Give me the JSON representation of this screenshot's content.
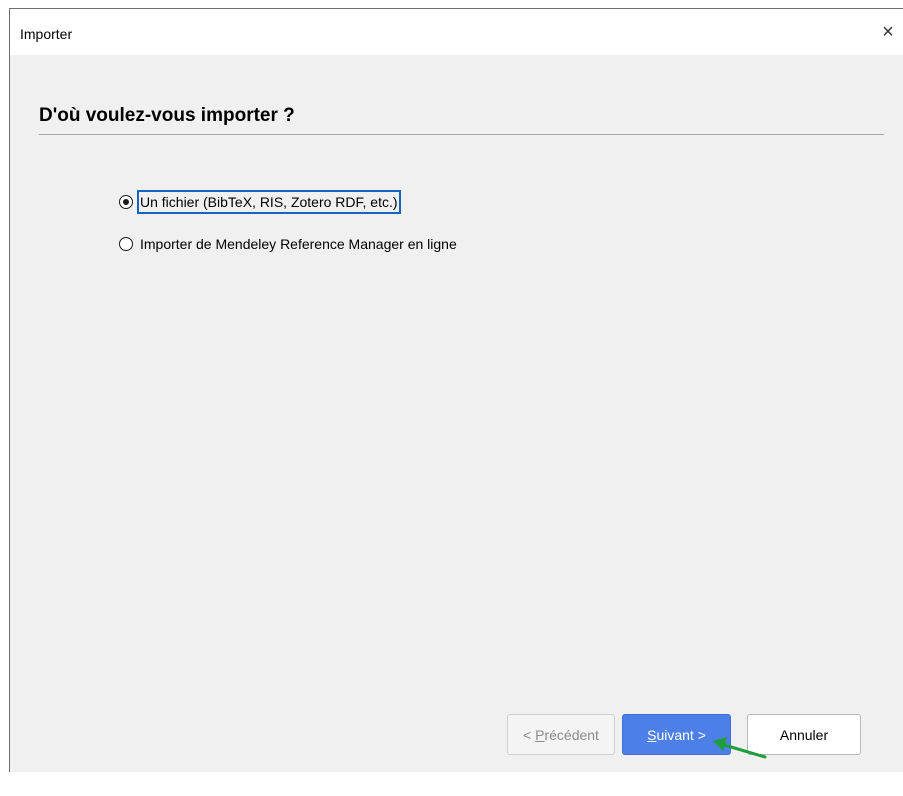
{
  "window": {
    "title": "Importer",
    "close_glyph": "×"
  },
  "heading": "D'où voulez-vous importer ?",
  "options": [
    {
      "label": "Un fichier (BibTeX, RIS, Zotero RDF, etc.)",
      "selected": true
    },
    {
      "label": "Importer de Mendeley Reference Manager en ligne",
      "selected": false
    }
  ],
  "buttons": {
    "prev": {
      "prefix": "< ",
      "mnemonic": "P",
      "rest": "récédent",
      "enabled": false
    },
    "next": {
      "mnemonic": "S",
      "rest": "uivant >",
      "enabled": true
    },
    "cancel": "Annuler"
  },
  "annotation": {
    "type": "arrow",
    "color": "#1f9e3a",
    "points_to": "next-button"
  },
  "colors": {
    "accent": "#4d80e6",
    "focus_ring": "#1565c0"
  }
}
